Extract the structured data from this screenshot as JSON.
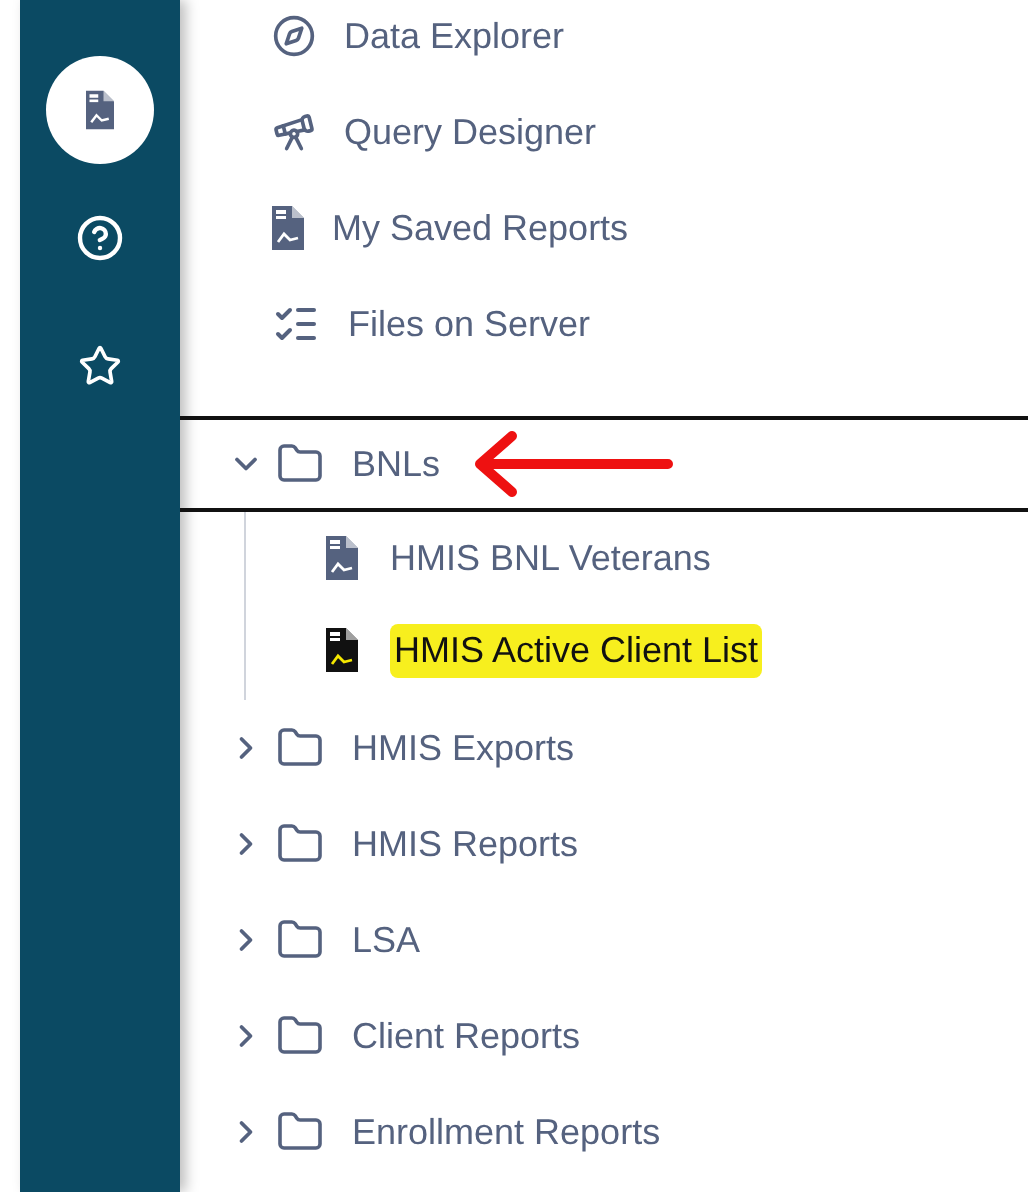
{
  "rail": {
    "items": [
      {
        "kind": "report",
        "selected": true
      },
      {
        "kind": "help",
        "selected": false
      },
      {
        "kind": "star",
        "selected": false
      }
    ]
  },
  "menu": [
    {
      "kind": "explorer",
      "label": "Data Explorer"
    },
    {
      "kind": "telescope",
      "label": "Query Designer"
    },
    {
      "kind": "report",
      "label": "My Saved Reports"
    },
    {
      "kind": "checklist",
      "label": "Files on Server"
    }
  ],
  "tree": [
    {
      "label": "BNLs",
      "expanded": true,
      "outlined": true,
      "children": [
        {
          "label": "HMIS BNL Veterans",
          "highlighted": false
        },
        {
          "label": "HMIS Active Client List",
          "highlighted": true
        }
      ]
    },
    {
      "label": "HMIS Exports",
      "expanded": false,
      "outlined": false
    },
    {
      "label": "HMIS Reports",
      "expanded": false,
      "outlined": false
    },
    {
      "label": "LSA",
      "expanded": false,
      "outlined": false
    },
    {
      "label": "Client Reports",
      "expanded": false,
      "outlined": false
    },
    {
      "label": "Enrollment Reports",
      "expanded": false,
      "outlined": false
    }
  ]
}
